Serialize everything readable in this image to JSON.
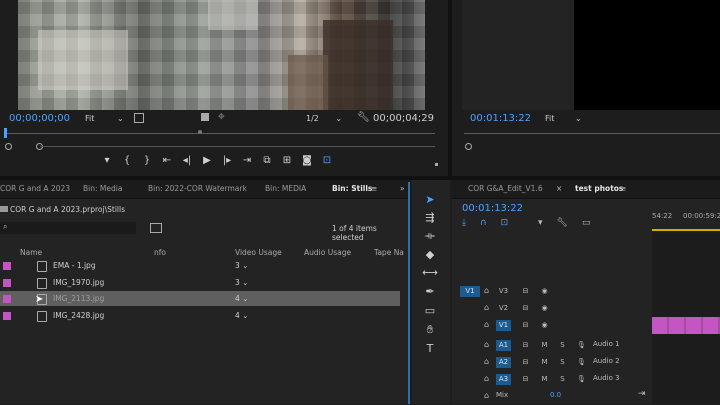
{
  "source_monitor": {
    "timecode": "00;00;00;00",
    "fit": "Fit",
    "resolution": "1/2",
    "duration": "00;00;04;29"
  },
  "program_monitor": {
    "timecode": "00:01:13:22",
    "fit": "Fit"
  },
  "project": {
    "tabs": [
      "COR G and A 2023",
      "Bin: Media",
      "Bin: 2022-COR Watermark",
      "Bin: MEDIA",
      "Bin: Stills"
    ],
    "path": "COR G and A 2023.prproj\\Stills",
    "items_selected": "1 of 4 items selected",
    "columns": [
      "Name",
      "nfo",
      "Video Usage",
      "Audio Usage",
      "Tape Na"
    ],
    "rows": [
      {
        "name": "EMA - 1.jpg",
        "usage": "3"
      },
      {
        "name": "IMG_1970.jpg",
        "usage": "3"
      },
      {
        "name": "IMG_2113.jpg",
        "usage": "4"
      },
      {
        "name": "IMG_2428.jpg",
        "usage": "4"
      }
    ]
  },
  "timeline": {
    "tabs": [
      "COR G&A_Edit_V1.6",
      "test photos"
    ],
    "timecode": "00:01:13:22",
    "ruler_labels": [
      "54:22",
      "00:00:59:22"
    ],
    "video_tracks": [
      "V3",
      "V2",
      "V1"
    ],
    "audio_tracks": [
      {
        "id": "A1",
        "name": "Audio 1"
      },
      {
        "id": "A2",
        "name": "Audio 2"
      },
      {
        "id": "A3",
        "name": "Audio 3"
      }
    ],
    "source_patch": "V1",
    "mute_label": "M",
    "solo_label": "S",
    "mix_label": "Mix",
    "mix_value": "0.0"
  },
  "colors": {
    "accent": "#4aa3ff",
    "clip": "#c356c4",
    "track_selected": "#1e5a8c"
  }
}
